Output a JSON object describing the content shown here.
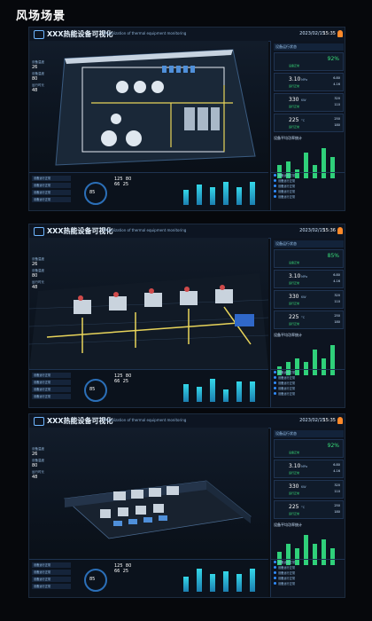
{
  "page_title": "风场场景",
  "screens": [
    {
      "sys_title": "XXX热能设备可视化",
      "subtitle": "Visualization of thermal equipment monitoring",
      "date": "2023/02/15",
      "time": "15:35",
      "left_info": [
        {
          "label": "设备温度",
          "value": "26"
        },
        {
          "label": "设备温度",
          "value": "80"
        },
        {
          "label": "运行时长",
          "value": "48"
        }
      ],
      "right_cards": [
        {
          "big": "",
          "pct": "92%",
          "tag": "设备正常"
        },
        {
          "big": "3.10",
          "unit": "MPa",
          "sm1": "6.80",
          "sm2": "4.16",
          "tag": "运行正常"
        },
        {
          "big": "330",
          "unit": "KW",
          "sm1": "320",
          "sm2": "110",
          "tag": "运行正常"
        },
        {
          "big": "225",
          "unit": "°C",
          "sm1": "250",
          "sm2": "180",
          "tag": "运行正常"
        }
      ],
      "right_section": "设备运行状态",
      "chart_title": "设备平均功率统计",
      "chart_values": [
        3,
        4,
        2,
        6,
        3,
        7,
        5
      ],
      "gauge_value": "85",
      "mid_values": [
        "125",
        "80",
        "66",
        "25"
      ],
      "bar_values": [
        6,
        8,
        7,
        9,
        7,
        9
      ],
      "list_items": [
        "设备运行正常",
        "设备运行正常",
        "设备运行正常",
        "设备运行正常",
        "设备运行正常"
      ]
    },
    {
      "sys_title": "XXX热能设备可视化",
      "subtitle": "Visualization of thermal equipment monitoring",
      "date": "2023/02/15",
      "time": "15:36",
      "left_info": [
        {
          "label": "设备温度",
          "value": "26"
        },
        {
          "label": "设备温度",
          "value": "80"
        },
        {
          "label": "运行时长",
          "value": "48"
        }
      ],
      "right_cards": [
        {
          "big": "",
          "pct": "85%",
          "tag": "设备正常"
        },
        {
          "big": "3.10",
          "unit": "MPa",
          "sm1": "6.80",
          "sm2": "4.16",
          "tag": "运行正常"
        },
        {
          "big": "330",
          "unit": "KW",
          "sm1": "320",
          "sm2": "110",
          "tag": "运行正常"
        },
        {
          "big": "225",
          "unit": "°C",
          "sm1": "250",
          "sm2": "180",
          "tag": "运行正常"
        }
      ],
      "right_section": "设备运行状态",
      "chart_title": "设备平均功率统计",
      "chart_values": [
        2,
        3,
        4,
        3,
        6,
        4,
        7
      ],
      "gauge_value": "85",
      "mid_values": [
        "125",
        "80",
        "66",
        "25"
      ],
      "bar_values": [
        7,
        6,
        9,
        5,
        8,
        8
      ],
      "list_items": [
        "设备运行正常",
        "设备运行正常",
        "设备运行正常",
        "设备运行正常",
        "设备运行正常"
      ]
    },
    {
      "sys_title": "XXX热能设备可视化",
      "subtitle": "Visualization of thermal equipment monitoring",
      "date": "2023/02/15",
      "time": "15:35",
      "left_info": [
        {
          "label": "设备温度",
          "value": "26"
        },
        {
          "label": "设备温度",
          "value": "80"
        },
        {
          "label": "运行时长",
          "value": "48"
        }
      ],
      "right_cards": [
        {
          "big": "",
          "pct": "92%",
          "tag": "设备正常"
        },
        {
          "big": "3.10",
          "unit": "MPa",
          "sm1": "6.80",
          "sm2": "4.16",
          "tag": "运行正常"
        },
        {
          "big": "330",
          "unit": "KW",
          "sm1": "320",
          "sm2": "110",
          "tag": "运行正常"
        },
        {
          "big": "225",
          "unit": "°C",
          "sm1": "250",
          "sm2": "180",
          "tag": "运行正常"
        }
      ],
      "right_section": "设备运行状态",
      "chart_title": "设备平均功率统计",
      "chart_values": [
        3,
        5,
        4,
        7,
        5,
        6,
        4
      ],
      "gauge_value": "85",
      "mid_values": [
        "125",
        "80",
        "66",
        "25"
      ],
      "bar_values": [
        6,
        9,
        7,
        8,
        7,
        9
      ],
      "list_items": [
        "设备运行正常",
        "设备运行正常",
        "设备运行正常",
        "设备运行正常",
        "设备运行正常"
      ]
    }
  ]
}
